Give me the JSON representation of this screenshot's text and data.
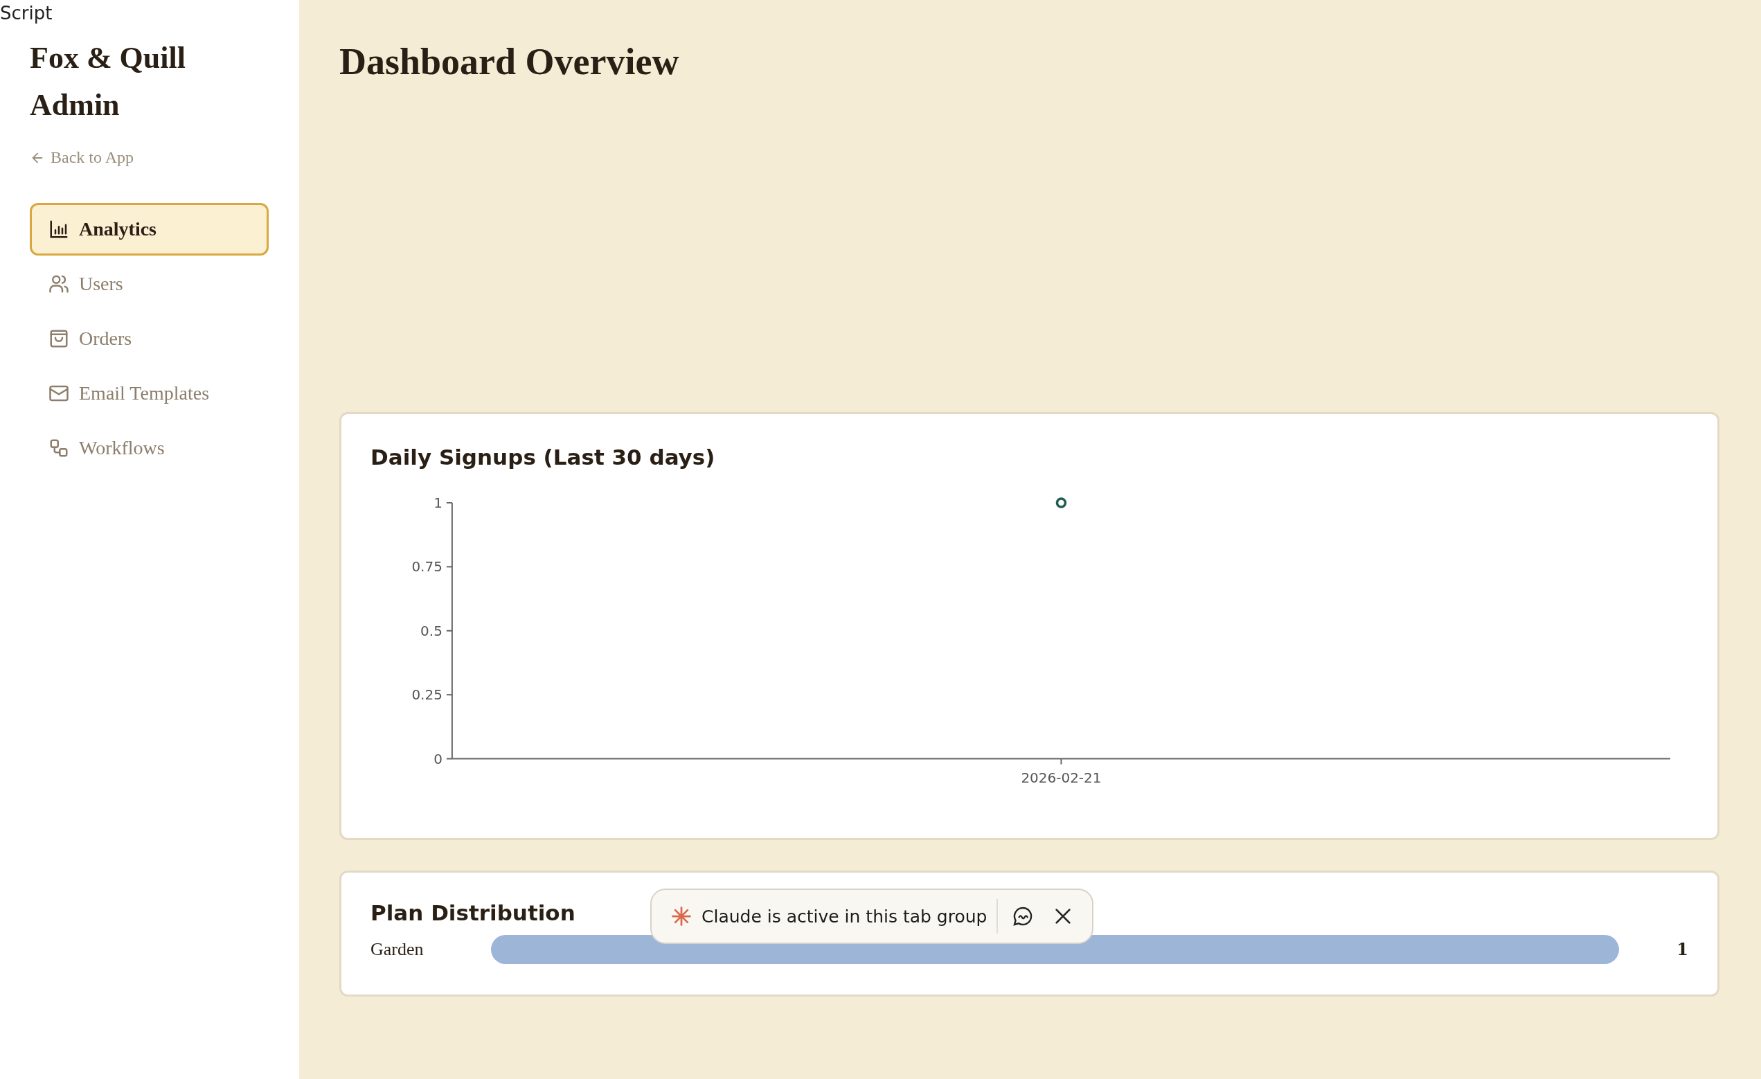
{
  "corner_label": "Script",
  "sidebar": {
    "title": "Fox & Quill Admin",
    "back_link": "Back to App",
    "items": [
      {
        "label": "Analytics",
        "kind": "chart",
        "selected": true
      },
      {
        "label": "Users",
        "kind": "users",
        "selected": false
      },
      {
        "label": "Orders",
        "kind": "bag",
        "selected": false
      },
      {
        "label": "Email Templates",
        "kind": "mail",
        "selected": false
      },
      {
        "label": "Workflows",
        "kind": "flow",
        "selected": false
      }
    ]
  },
  "page_title": "Dashboard Overview",
  "signups_card": {
    "title": "Daily Signups (Last 30 days)",
    "chart_data": {
      "type": "line",
      "categories": [
        "2026-02-21"
      ],
      "ylim": [
        0,
        1
      ],
      "yticks": [
        0,
        0.25,
        0.5,
        0.75,
        1
      ],
      "series": [
        {
          "color": "#1f5c4f",
          "marker": "circle",
          "values": [
            1
          ]
        }
      ]
    }
  },
  "plan_card": {
    "title": "Plan Distribution",
    "plans": [
      {
        "name": "Garden",
        "level": 1,
        "count": "1"
      }
    ]
  },
  "toast": {
    "message": "Claude is active in this tab group"
  }
}
